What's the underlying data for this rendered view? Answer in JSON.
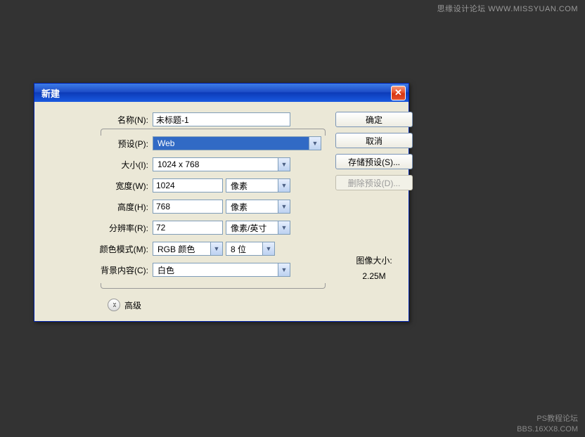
{
  "watermarks": {
    "top": "思缘设计论坛  WWW.MISSYUAN.COM",
    "bottom_line1": "PS教程论坛",
    "bottom_line2": "BBS.16XX8.COM"
  },
  "dialog": {
    "title": "新建",
    "close_symbol": "✕",
    "labels": {
      "name": "名称(N):",
      "preset": "预设(P):",
      "size": "大小(I):",
      "width": "宽度(W):",
      "height": "高度(H):",
      "resolution": "分辨率(R):",
      "color_mode": "颜色模式(M):",
      "background": "背景内容(C):",
      "advanced": "高级"
    },
    "values": {
      "name": "未标题-1",
      "preset": "Web",
      "size": "1024 x 768",
      "width": "1024",
      "height": "768",
      "resolution": "72",
      "color_mode": "RGB 颜色",
      "bit_depth": "8 位",
      "background": "白色",
      "width_unit": "像素",
      "height_unit": "像素",
      "resolution_unit": "像素/英寸"
    },
    "buttons": {
      "ok": "确定",
      "cancel": "取消",
      "save_preset": "存储预设(S)...",
      "delete_preset": "删除预设(D)..."
    },
    "info": {
      "image_size_label": "图像大小:",
      "image_size_value": "2.25M"
    },
    "adv_chevron": "▾▴"
  }
}
